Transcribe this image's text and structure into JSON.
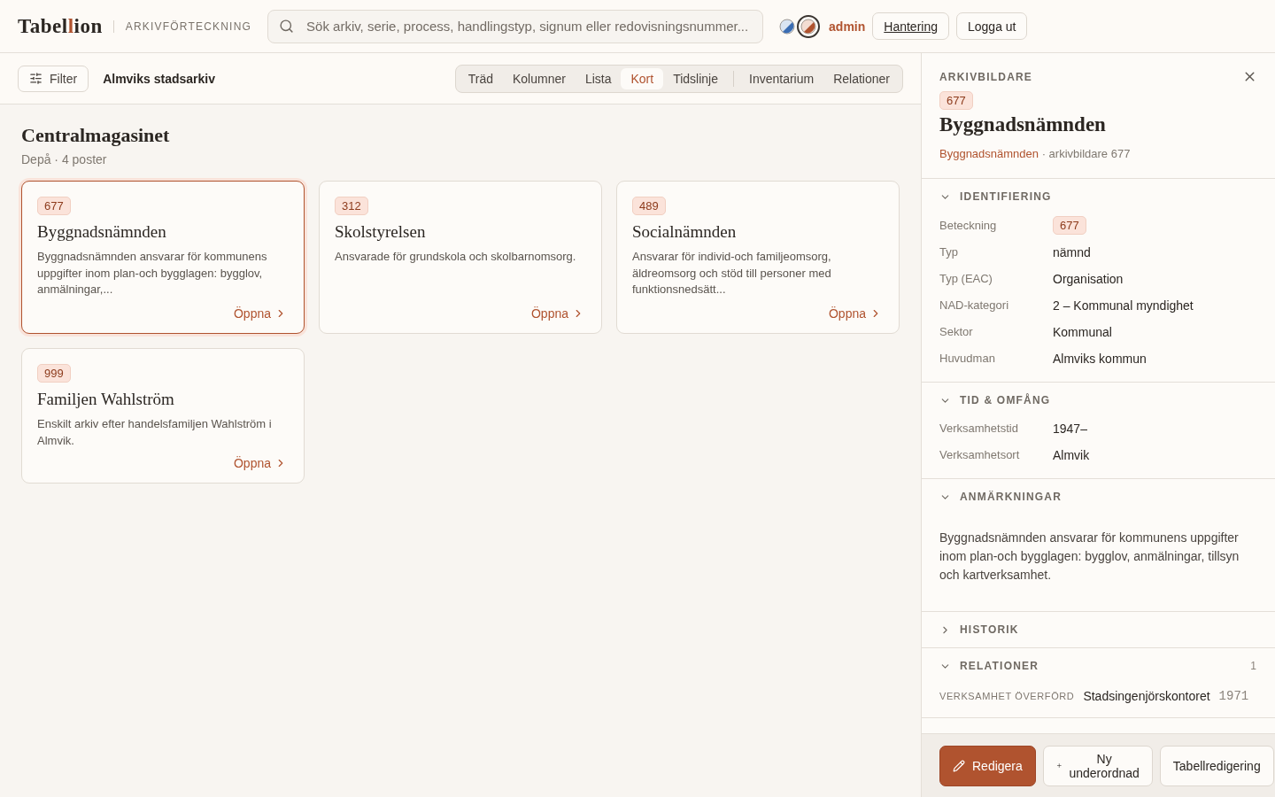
{
  "header": {
    "logo": {
      "before": "Tabel",
      "accent": "l",
      "after": "ion"
    },
    "subtitle": "ARKIVFÖRTECKNING",
    "search": {
      "placeholder": "Sök arkiv, serie, process, handlingstyp, signum eller redovisningsnummer..."
    },
    "theme_toggle": [
      {
        "selected": false
      },
      {
        "selected": true
      }
    ],
    "user": "admin",
    "buttons": [
      {
        "label": "Hantering",
        "kind": "link"
      },
      {
        "label": "Logga ut",
        "kind": "plain"
      }
    ]
  },
  "toolbar": {
    "filter": "Filter",
    "archive": "Almviks stadsarkiv",
    "view_groups": [
      [
        {
          "label": "Träd",
          "selected": false
        },
        {
          "label": "Kolumner",
          "selected": false
        },
        {
          "label": "Lista",
          "selected": false
        },
        {
          "label": "Kort",
          "selected": true
        },
        {
          "label": "Tidslinje",
          "selected": false
        }
      ],
      [
        {
          "label": "Inventarium",
          "selected": false
        },
        {
          "label": "Relationer",
          "selected": false
        }
      ]
    ]
  },
  "main": {
    "title": "Centralmagasinet",
    "subtitle": "Depå · 4 poster",
    "cards": [
      {
        "code": "677",
        "title": "Byggnadsnämnden",
        "text": "Byggnadsnämnden ansvarar för kommunens uppgifter inom plan-och bygglagen: bygglov, anmälningar,...",
        "link": "Öppna",
        "selected": true
      },
      {
        "code": "312",
        "title": "Skolstyrelsen",
        "text": "Ansvarade för grundskola och skolbarnomsorg.",
        "link": "Öppna",
        "selected": false
      },
      {
        "code": "489",
        "title": "Socialnämnden",
        "text": "Ansvarar för individ-och familjeomsorg, äldreomsorg och stöd till personer med funktionsnedsätt...",
        "link": "Öppna",
        "selected": false
      },
      {
        "code": "999",
        "title": "Familjen Wahlström",
        "text": "Enskilt arkiv efter handelsfamiljen Wahlström i Almvik.",
        "link": "Öppna",
        "selected": false
      }
    ]
  },
  "panel": {
    "kicker": "ARKIVBILDARE",
    "code": "677",
    "title": "Byggnadsnämnden",
    "breadcrumb_link": "Byggnadsnämnden",
    "breadcrumb_rest": "· arkivbildare 677",
    "sections": [
      {
        "kind": "fields",
        "title": "IDENTIFIERING",
        "expanded": true,
        "fields": [
          {
            "label": "Beteckning",
            "value": "677",
            "kind": "badge"
          },
          {
            "label": "Typ",
            "value": "nämnd",
            "kind": "text"
          },
          {
            "label": "Typ (EAC)",
            "value": "Organisation",
            "kind": "text"
          },
          {
            "label": "NAD-kategori",
            "value": "2 – Kommunal myndighet",
            "kind": "text"
          },
          {
            "label": "Sektor",
            "value": "Kommunal",
            "kind": "text"
          },
          {
            "label": "Huvudman",
            "value": "Almviks kommun",
            "kind": "text"
          }
        ]
      },
      {
        "kind": "fields",
        "title": "TID & OMFÅNG",
        "expanded": true,
        "fields": [
          {
            "label": "Verksamhetstid",
            "value": "1947–",
            "kind": "text"
          },
          {
            "label": "Verksamhetsort",
            "value": "Almvik",
            "kind": "text"
          }
        ]
      },
      {
        "kind": "text",
        "title": "ANMÄRKNINGAR",
        "expanded": true,
        "text": "Byggnadsnämnden ansvarar för kommunens uppgifter inom plan-och bygglagen: bygglov, anmälningar, tillsyn och kartverksamhet."
      },
      {
        "title": "HISTORIK",
        "expanded": false
      },
      {
        "kind": "relations",
        "title": "RELATIONER",
        "expanded": true,
        "count": "1",
        "relations": [
          {
            "type": "VERKSAMHET ÖVERFÖRD",
            "name": "Stadsingenjörskontoret",
            "year": "1971"
          }
        ]
      }
    ],
    "actions": [
      {
        "label": "Redigera",
        "kind": "primary"
      },
      {
        "label": "Ny underordnad",
        "kind": "add"
      },
      {
        "label": "Tabellredigering",
        "kind": "plain"
      }
    ]
  }
}
